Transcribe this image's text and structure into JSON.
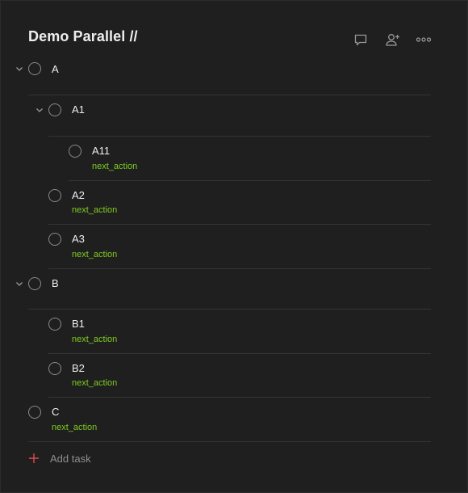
{
  "project": {
    "title": "Demo Parallel //"
  },
  "header": {
    "icons": [
      "comment-icon",
      "add-person-icon",
      "more-icon"
    ]
  },
  "tasks": [
    {
      "name": "A",
      "label": "",
      "indent": 0,
      "collapsible": true
    },
    {
      "name": "A1",
      "label": "",
      "indent": 1,
      "collapsible": true
    },
    {
      "name": "A11",
      "label": "next_action",
      "indent": 2,
      "collapsible": false
    },
    {
      "name": "A2",
      "label": "next_action",
      "indent": 1,
      "collapsible": false
    },
    {
      "name": "A3",
      "label": "next_action",
      "indent": 1,
      "collapsible": false
    },
    {
      "name": "B",
      "label": "",
      "indent": 0,
      "collapsible": true
    },
    {
      "name": "B1",
      "label": "next_action",
      "indent": 1,
      "collapsible": false
    },
    {
      "name": "B2",
      "label": "next_action",
      "indent": 1,
      "collapsible": false
    },
    {
      "name": "C",
      "label": "next_action",
      "indent": 0,
      "collapsible": false
    }
  ],
  "add_task": {
    "label": "Add task"
  },
  "colors": {
    "background": "#1f1f1f",
    "label_green": "#7ecb20",
    "add_plus_red": "#de4c4a",
    "divider": "#353535"
  }
}
